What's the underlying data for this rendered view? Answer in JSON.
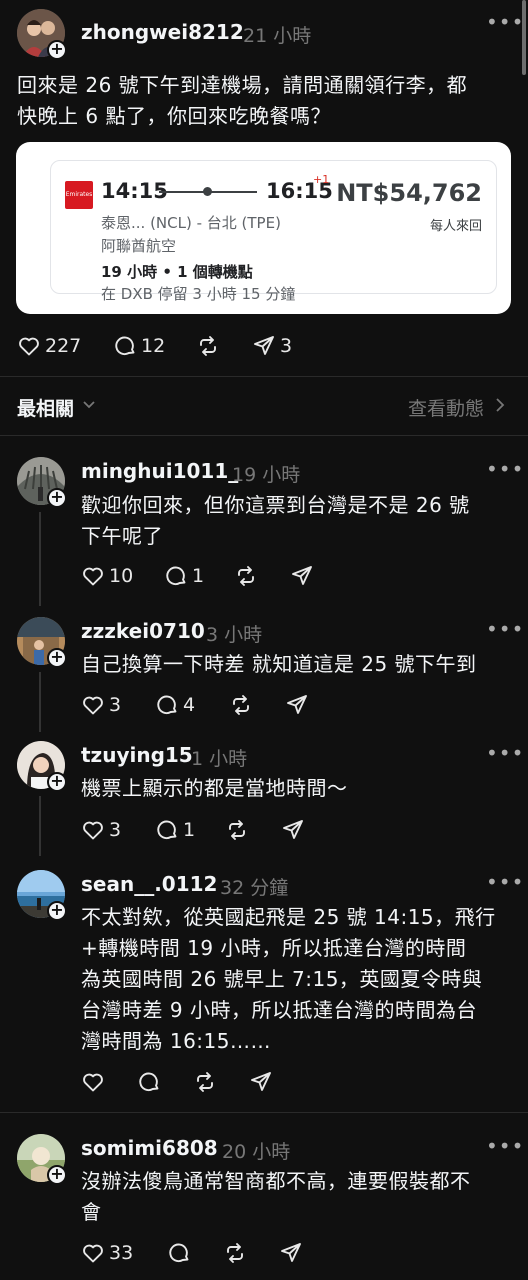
{
  "post": {
    "username": "zhongwei8212",
    "time": "21 小時",
    "text_line1": "回來是 26 號下午到達機場，請問通關領行李，都",
    "text_line2": "快晚上 6 點了，你回來吃晚餐嗎？",
    "flight_card": {
      "airline_logo_text": "Emirates",
      "depart": "14:15",
      "arrive": "16:15",
      "day_offset": "+1",
      "route": "泰恩... (NCL) - 台北 (TPE)",
      "airline": "阿聯酋航空",
      "duration": "19 小時 • 1 個轉機點",
      "layover": "在 DXB 停留 3 小時 15 分鐘",
      "price": "NT$54,762",
      "price_note": "每人來回"
    },
    "likes": "227",
    "comments": "12",
    "reposts": "3"
  },
  "sort": {
    "label": "最相關",
    "activity_label": "查看動態"
  },
  "replies": [
    {
      "username": "minghui1011_",
      "time": "19 小時",
      "lines": [
        "歡迎你回來，但你這票到台灣是不是 26 號",
        "下午呢了"
      ],
      "likes": "10",
      "comments": "1",
      "reposts": ""
    },
    {
      "username": "zzzkei0710",
      "time": "3 小時",
      "lines": [
        "自己換算一下時差 就知道這是 25 號下午到"
      ],
      "likes": "3",
      "comments": "4",
      "reposts": ""
    },
    {
      "username": "tzuying15",
      "time": "1 小時",
      "lines": [
        "機票上顯示的都是當地時間～"
      ],
      "likes": "3",
      "comments": "1",
      "reposts": ""
    },
    {
      "username": "sean__.0112",
      "time": "32 分鐘",
      "lines": [
        "不太對欸，從英國起飛是 25 號 14:15，飛行",
        "+轉機時間 19 小時，所以抵達台灣的時間",
        "為英國時間 26 號早上 7:15，英國夏令時與",
        "台灣時差 9 小時，所以抵達台灣的時間為台",
        "灣時間為 16:15……"
      ],
      "likes": "",
      "comments": "",
      "reposts": ""
    },
    {
      "username": "somimi6808",
      "time": "20 小時",
      "lines": [
        "沒辦法傻鳥通常智商都不高，連要假裝都不",
        "會"
      ],
      "likes": "33",
      "comments": "",
      "reposts": ""
    }
  ],
  "colors": {
    "background": "#101010",
    "text": "#f3f5f7",
    "muted": "#777777",
    "emirates_red": "#d71921"
  }
}
